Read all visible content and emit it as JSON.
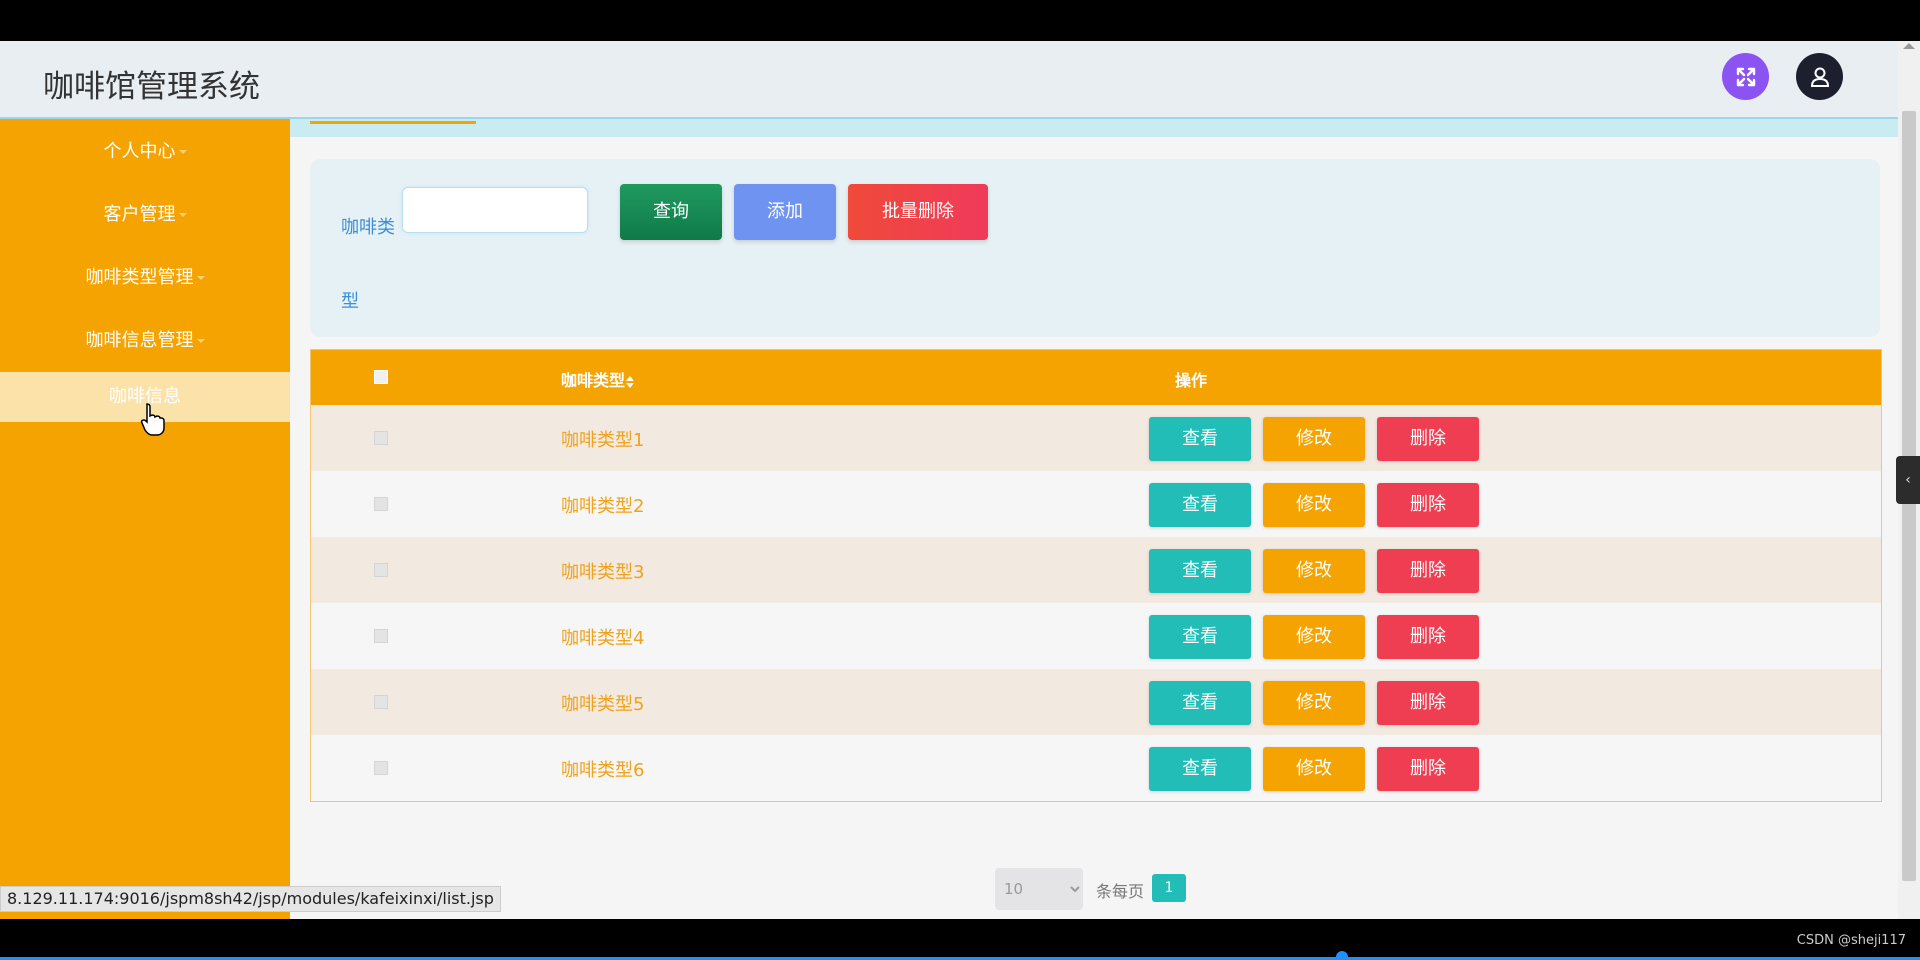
{
  "app": {
    "title": "咖啡馆管理系统"
  },
  "header": {
    "expand_icon": "expand-arrows-icon",
    "user_icon": "user-icon"
  },
  "sidebar": {
    "items": [
      {
        "label": "个人中心"
      },
      {
        "label": "客户管理"
      },
      {
        "label": "咖啡类型管理"
      },
      {
        "label": "咖啡信息管理"
      }
    ],
    "active_sub": {
      "label": "咖啡信息"
    }
  },
  "search": {
    "label_line1": "咖啡类",
    "label_line2": "型",
    "input_value": "",
    "query_label": "查询",
    "add_label": "添加",
    "batch_delete_label": "批量删除"
  },
  "table": {
    "columns": [
      "咖啡类型",
      "操作"
    ],
    "sort_icon": "sort-icon",
    "rows": [
      {
        "type": "咖啡类型1",
        "view": "查看",
        "edit": "修改",
        "delete": "删除"
      },
      {
        "type": "咖啡类型2",
        "view": "查看",
        "edit": "修改",
        "delete": "删除"
      },
      {
        "type": "咖啡类型3",
        "view": "查看",
        "edit": "修改",
        "delete": "删除"
      },
      {
        "type": "咖啡类型4",
        "view": "查看",
        "edit": "修改",
        "delete": "删除"
      },
      {
        "type": "咖啡类型5",
        "view": "查看",
        "edit": "修改",
        "delete": "删除"
      },
      {
        "type": "咖啡类型6",
        "view": "查看",
        "edit": "修改",
        "delete": "删除"
      }
    ]
  },
  "pagination": {
    "page_size": "10",
    "per_page_label": "条每页",
    "current_page": "1"
  },
  "status_bar": {
    "url": "8.129.11.174:9016/jspm8sh42/jsp/modules/kafeixinxi/list.jsp"
  },
  "watermark": "CSDN @sheji117",
  "colors": {
    "sidebar": "#f5a301",
    "query": "#138a52",
    "add": "#6f93f0",
    "delete": "#ef3e51",
    "view": "#21bdb6",
    "edit": "#f5a301"
  }
}
